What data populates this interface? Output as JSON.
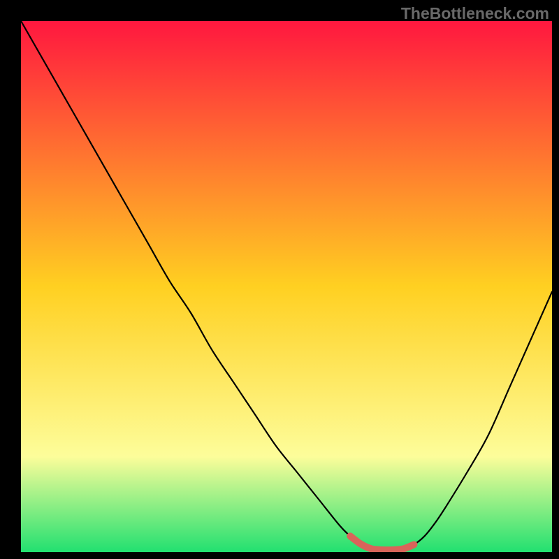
{
  "watermark": "TheBottleneck.com",
  "colors": {
    "bg": "#000000",
    "watermark": "#696969",
    "curve": "#000000",
    "marker": "#d9645a",
    "grad_top": "#ff173f",
    "grad_mid": "#ffd021",
    "grad_low": "#fdfd9a",
    "grad_bot": "#22e070"
  },
  "chart_data": {
    "type": "line",
    "title": "",
    "xlabel": "",
    "ylabel": "",
    "xlim": [
      0,
      100
    ],
    "ylim": [
      0,
      100
    ],
    "x": [
      0,
      4,
      8,
      12,
      16,
      20,
      24,
      28,
      32,
      36,
      40,
      44,
      48,
      52,
      56,
      60,
      62,
      64,
      66,
      68,
      70,
      72,
      74,
      76,
      78,
      80,
      84,
      88,
      92,
      96,
      100
    ],
    "y": [
      100,
      93,
      86,
      79,
      72,
      65,
      58,
      51,
      45,
      38,
      32,
      26,
      20,
      15,
      10,
      5,
      3,
      1.5,
      0.6,
      0.4,
      0.4,
      0.6,
      1.4,
      3,
      5.5,
      8.5,
      15,
      22,
      31,
      40,
      49
    ],
    "marker_segment": {
      "x": [
        62,
        64,
        66,
        68,
        70,
        72,
        74
      ],
      "y": [
        3,
        1.5,
        0.6,
        0.4,
        0.4,
        0.6,
        1.4
      ]
    }
  }
}
